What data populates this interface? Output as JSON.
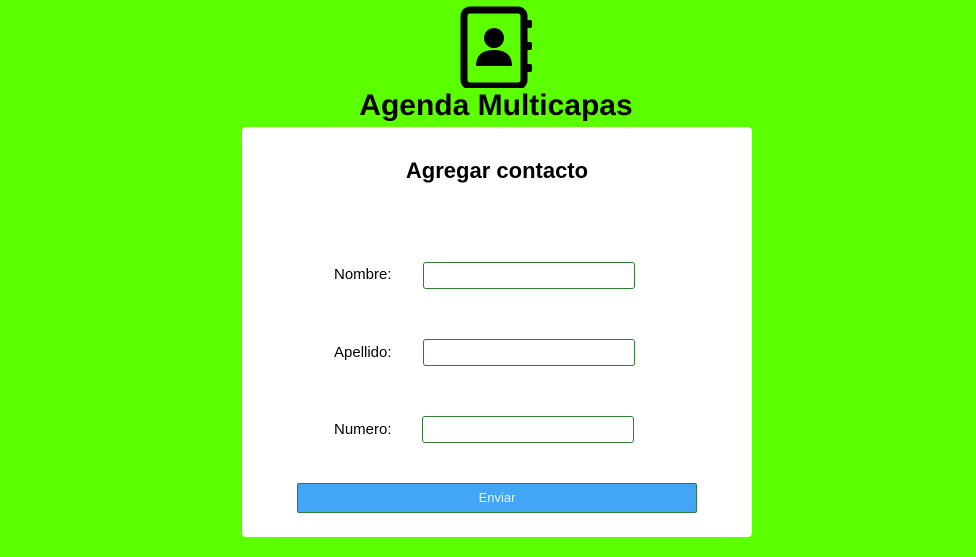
{
  "header": {
    "logo_icon": "address-book-icon",
    "title": "Agenda Multicapas"
  },
  "form": {
    "title": "Agregar contacto",
    "fields": [
      {
        "label": "Nombre:",
        "value": "",
        "placeholder": ""
      },
      {
        "label": "Apellido:",
        "value": "",
        "placeholder": ""
      },
      {
        "label": "Numero:",
        "value": "",
        "placeholder": ""
      }
    ],
    "submit_label": "Enviar"
  },
  "colors": {
    "background": "#5cff00",
    "card": "#ffffff",
    "button": "#42a5f5",
    "input_border": "#2e7d32"
  }
}
